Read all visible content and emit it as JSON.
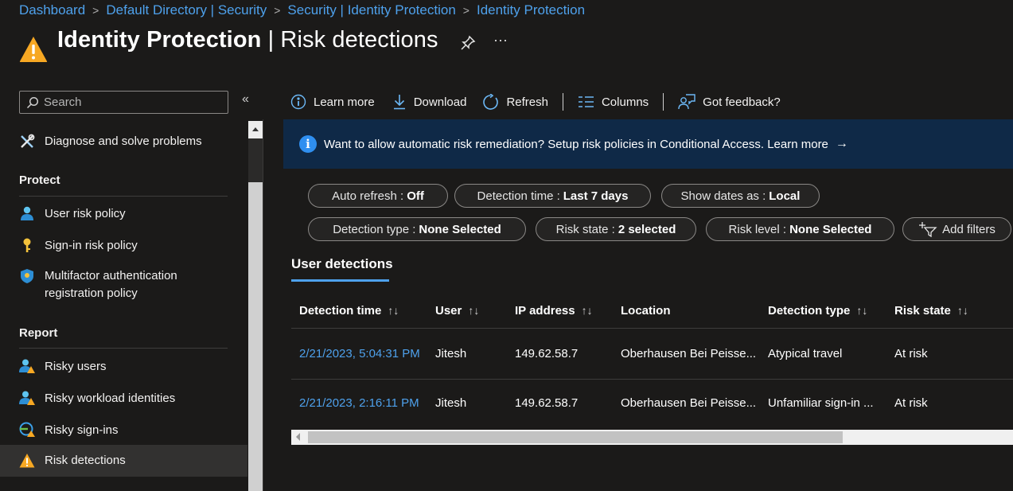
{
  "breadcrumb": [
    "Dashboard",
    "Default Directory | Security",
    "Security | Identity Protection",
    "Identity Protection"
  ],
  "header": {
    "title_bold": "Identity Protection",
    "title_rest": " | Risk detections",
    "more": "···"
  },
  "sidebar": {
    "search_placeholder": "Search",
    "collapse": "«",
    "top_item": "Diagnose and solve problems",
    "sections": [
      {
        "title": "Protect",
        "items": [
          "User risk policy",
          "Sign-in risk policy",
          "Multifactor authentication registration policy"
        ]
      },
      {
        "title": "Report",
        "items": [
          "Risky users",
          "Risky workload identities",
          "Risky sign-ins",
          "Risk detections"
        ]
      }
    ]
  },
  "toolbar": {
    "learn_more": "Learn more",
    "download": "Download",
    "refresh": "Refresh",
    "columns": "Columns",
    "feedback": "Got feedback?"
  },
  "banner": {
    "icon": "i",
    "text": "Want to allow automatic risk remediation? Setup risk policies in Conditional Access. Learn more",
    "arrow": "→"
  },
  "filters": [
    {
      "label": "Auto refresh :",
      "value": "Off"
    },
    {
      "label": "Detection time :",
      "value": "Last 7 days"
    },
    {
      "label": "Show dates as :",
      "value": "Local"
    },
    {
      "label": "Detection type :",
      "value": "None Selected"
    },
    {
      "label": "Risk state :",
      "value": "2 selected"
    },
    {
      "label": "Risk level :",
      "value": "None Selected"
    }
  ],
  "add_filters": "Add filters",
  "tab": "User detections",
  "table": {
    "columns": [
      "Detection time",
      "User",
      "IP address",
      "Location",
      "Detection type",
      "Risk state"
    ],
    "sort_glyph": "↑↓",
    "rows": [
      [
        "2/21/2023, 5:04:31 PM",
        "Jitesh",
        "149.62.58.7",
        "Oberhausen Bei Peisse...",
        "Atypical travel",
        "At risk"
      ],
      [
        "2/21/2023, 2:16:11 PM",
        "Jitesh",
        "149.62.58.7",
        "Oberhausen Bei Peisse...",
        "Unfamiliar sign-in ...",
        "At risk"
      ]
    ]
  },
  "colors": {
    "accent": "#4ea1ec",
    "banner_bg": "#0f2947",
    "warning": "#f7a823"
  }
}
